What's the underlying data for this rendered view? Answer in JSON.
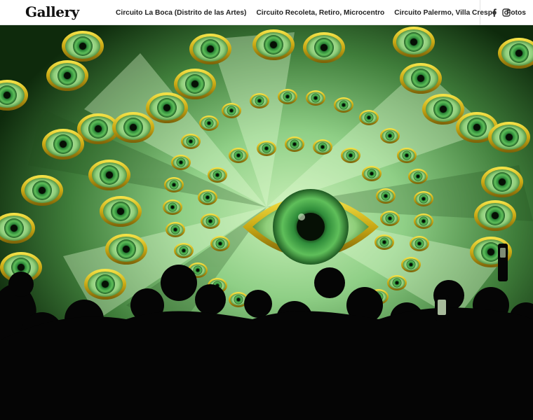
{
  "header": {
    "logo": "Gallery",
    "nav": [
      {
        "id": "la-boca",
        "label": "Circuito La Boca (Distrito de las Artes)"
      },
      {
        "id": "recoleta",
        "label": "Circuito Recoleta, Retiro, Microcentro"
      },
      {
        "id": "palermo",
        "label": "Circuito Palermo, Villa Crespo"
      },
      {
        "id": "fotos",
        "label": "Fotos"
      }
    ],
    "social": {
      "facebook": "facebook-icon",
      "instagram": "instagram-icon"
    }
  },
  "hero": {
    "image": "kaleidoscope-eyes-projection-with-crowd-silhouettes",
    "colors": {
      "iris": "#2e8a3a",
      "ring": "#d8c21a",
      "background": "#9fd59a",
      "crowd": "#050505"
    }
  }
}
